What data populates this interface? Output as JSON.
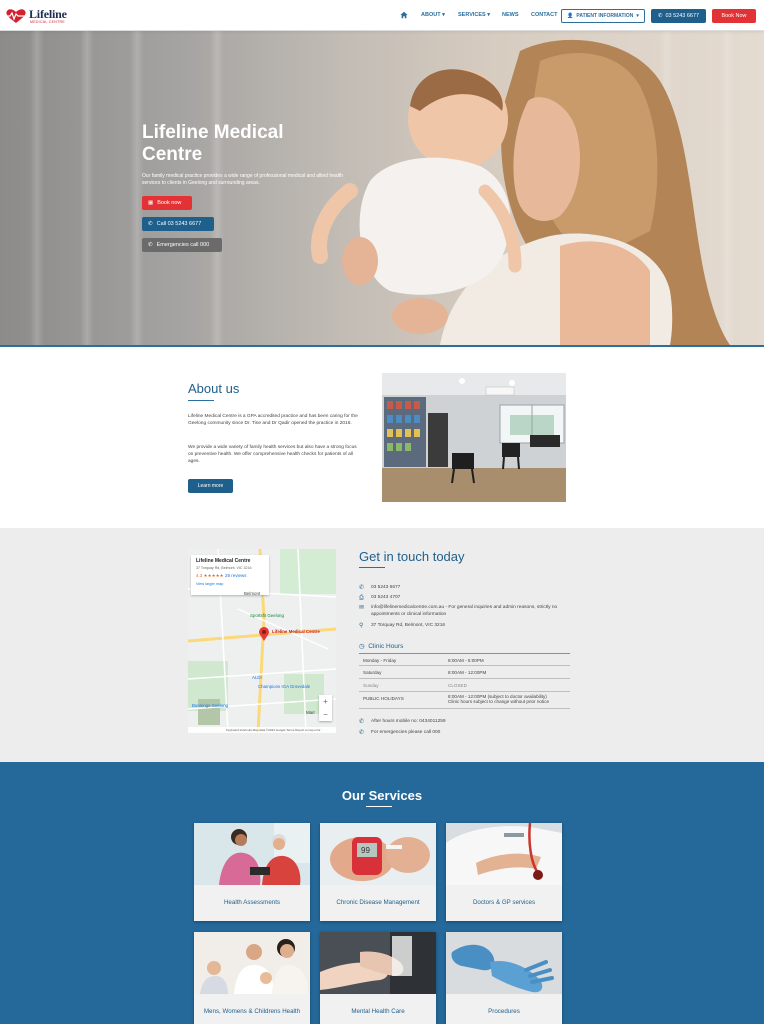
{
  "header": {
    "logo_name": "Lifeline",
    "logo_sub": "MEDICAL CENTRE",
    "nav": {
      "about": "ABOUT",
      "services": "SERVICES",
      "news": "NEWS",
      "contact": "CONTACT"
    },
    "patient_info": "PATIENT INFORMATION",
    "phone": "03 5243 6677",
    "book_now": "Book Now"
  },
  "hero": {
    "title": "Lifeline Medical Centre",
    "text": "Our family medical practice provides a wide range of professional medical and allied health services to clients in Geelong and surrounding areas.",
    "book_now": "Book now",
    "call": "Call 03 5243 6677",
    "emergencies": "Emergencies call 000"
  },
  "about": {
    "title": "About us",
    "p1": "Lifeline Medical Centre is a GPA accredited practice and has been caring for the Geelong community since Dr. Tine and Dr Qadir opened the practice in 2016.",
    "p2": "We provide a wide variety of family health services but also have a strong focus on preventive health. We offer comprehensive health checks for patients of all ages.",
    "learn_more": "Learn more"
  },
  "map": {
    "name": "Lifeline Medical Centre",
    "address": "37 Torquay Rd, Belmont, VIC 3216",
    "rating": "4.3",
    "stars": "★★★★★",
    "reviews": "28 reviews",
    "view_larger": "View larger map",
    "pin_label": "Lifeline Medical Centre",
    "labels": {
      "belmont": "Belmont",
      "sportsfit": "Sportsfit Geelong",
      "champions": "Champions IGA Grovedale",
      "bunnings": "Bunnings Geelong",
      "mar": "Marr",
      "aldi": "ALDI"
    },
    "footer": "Keyboard shortcuts   Map data ©2024 Google   Terms   Report a map error"
  },
  "contact": {
    "title": "Get in touch today",
    "phone": "03 5243 6677",
    "fax": "03 5243 4707",
    "email": "info@lifelinemedicalcentre.com.au - For general inquiries and admin reasons, strictly no appointments or clinical information",
    "address": "37 Torquay Rd, Belmont, VIC 3216",
    "hours_title": "Clinic Hours",
    "hours": [
      {
        "day": "Monday - Friday",
        "time": "8:00AM - 5:00PM"
      },
      {
        "day": "Saturday",
        "time": "8:00AM - 12:00PM"
      },
      {
        "day": "Sunday",
        "time": "CLOSED"
      },
      {
        "day": "PUBLIC HOLIDAYS",
        "time": "8:00AM - 12:00PM (subject to doctor availability)",
        "note": "Clinic hours subject to change without prior notice"
      }
    ],
    "after_hours": "After hours mobile no: 0434011259",
    "emergencies": "For emergencies please call 000"
  },
  "services": {
    "title": "Our Services",
    "items": [
      {
        "label": "Health Assessments"
      },
      {
        "label": "Chronic Disease Management"
      },
      {
        "label": "Doctors & GP services"
      },
      {
        "label": "Mens, Womens & Childrens Health"
      },
      {
        "label": "Mental Health Care"
      },
      {
        "label": "Procedures"
      }
    ]
  },
  "colors": {
    "primary": "#1f5f8c",
    "accent_red": "#e33236",
    "services_bg": "#25689a"
  }
}
